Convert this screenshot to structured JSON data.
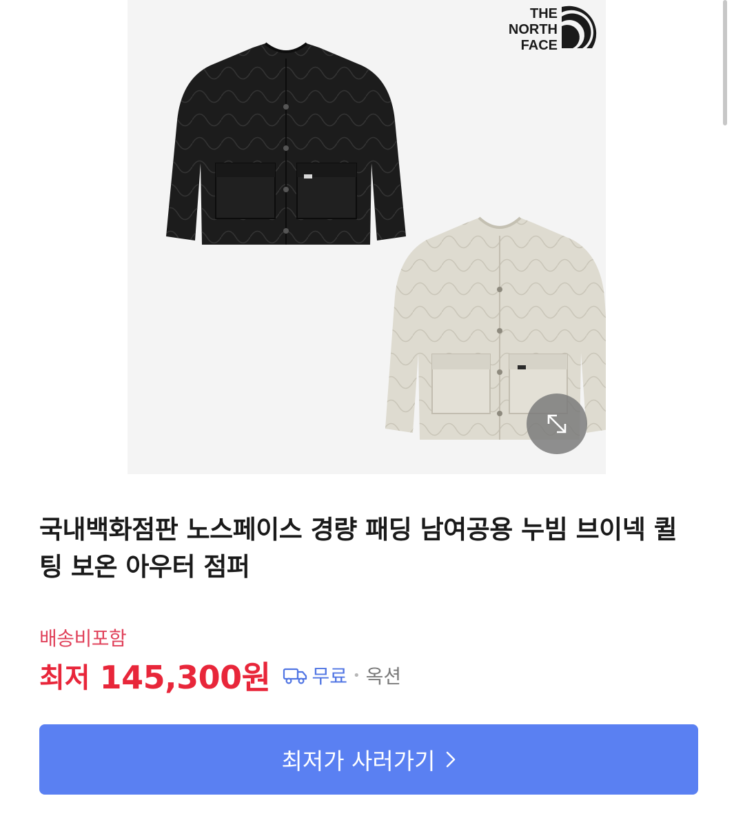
{
  "product": {
    "brand_logo_text": "THE NORTH FACE",
    "title": "국내백화점판 노스페이스 경량 패딩 남여공용 누빔 브이넥 퀼팅 보온 아우터 점퍼",
    "shipping_note": "배송비포함",
    "price_prefix": "최저",
    "price": "145,300원",
    "delivery": "무료",
    "separator": "•",
    "mall": "옥션",
    "buy_button": "최저가 사러가기"
  },
  "icons": {
    "zoom": "expand-icon",
    "delivery": "truck-icon",
    "button": "chevron-right-icon"
  },
  "colors": {
    "price": "#e8263a",
    "shipping_note": "#e0415a",
    "delivery": "#4f74e3",
    "button": "#5a80f2",
    "jacket_black": "#1c1c1c",
    "jacket_beige": "#dedbd0"
  }
}
